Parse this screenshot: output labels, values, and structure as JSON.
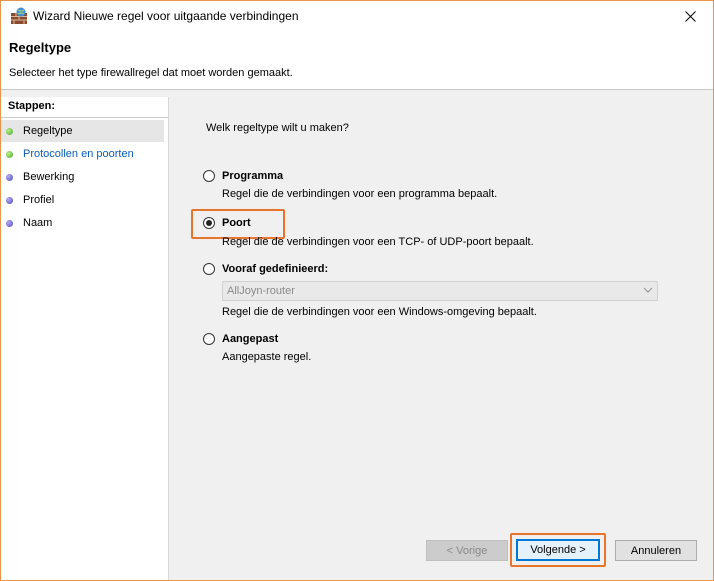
{
  "window": {
    "title": "Wizard Nieuwe regel voor uitgaande verbindingen",
    "close_glyph": "✕"
  },
  "header": {
    "title": "Regeltype",
    "subtitle": "Selecteer het type firewallregel dat moet worden gemaakt."
  },
  "steps": {
    "title": "Stappen:",
    "items": [
      {
        "label": "Regeltype"
      },
      {
        "label": "Protocollen en poorten"
      },
      {
        "label": "Bewerking"
      },
      {
        "label": "Profiel"
      },
      {
        "label": "Naam"
      }
    ]
  },
  "content": {
    "question": "Welk regeltype wilt u maken?",
    "options": [
      {
        "label": "Programma",
        "description": "Regel die de verbindingen voor een programma bepaalt.",
        "checked": false
      },
      {
        "label": "Poort",
        "description": "Regel die de verbindingen voor een TCP- of UDP-poort bepaalt.",
        "checked": true
      },
      {
        "label": "Vooraf gedefinieerd:",
        "description": "Regel die de verbindingen voor een Windows-omgeving bepaalt.",
        "checked": false
      },
      {
        "label": "Aangepast",
        "description": "Aangepaste regel.",
        "checked": false
      }
    ],
    "predefined_select": {
      "value": "AllJoyn-router",
      "enabled": false
    }
  },
  "buttons": {
    "back": "< Vorige",
    "next": "Volgende >",
    "cancel": "Annuleren"
  },
  "colors": {
    "highlight": "#e8752b",
    "link": "#0b5fb5",
    "step_done": "#4aa52a",
    "step_pending": "#4b44b8"
  }
}
